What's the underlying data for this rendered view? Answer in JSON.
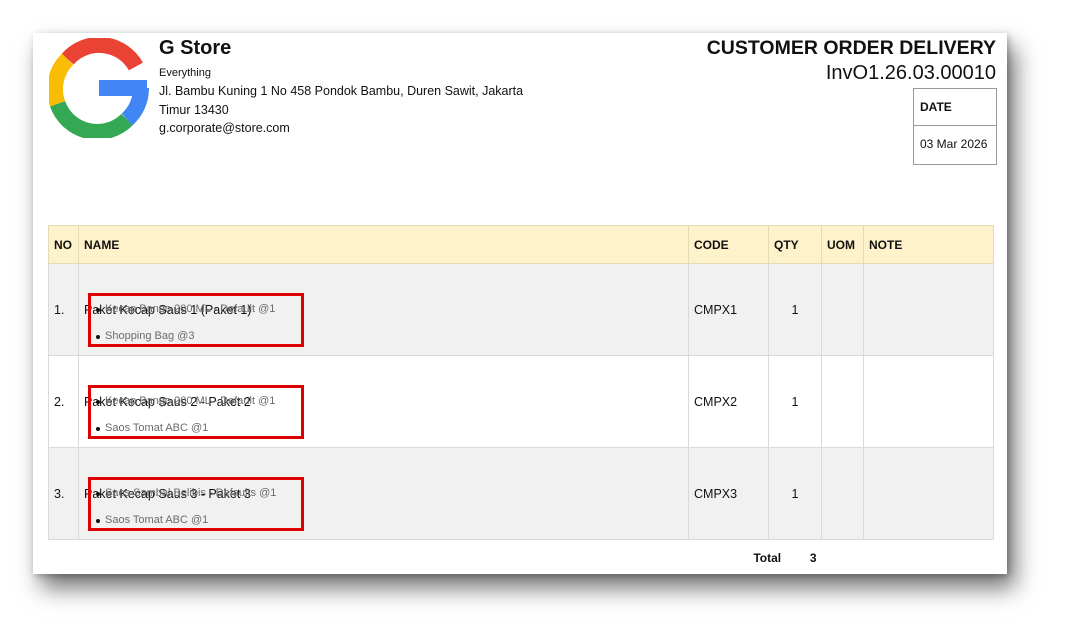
{
  "store": {
    "name": "G Store",
    "tagline": "Everything",
    "address": "Jl. Bambu Kuning 1 No 458 Pondok Bambu, Duren Sawit, Jakarta Timur 13430",
    "email": "g.corporate@store.com",
    "logo_icon": "google-g-logo"
  },
  "document": {
    "title": "CUSTOMER ORDER DELIVERY",
    "number": "InvO1.26.03.00010",
    "date_label": "DATE",
    "date_value": "03 Mar 2026"
  },
  "table": {
    "headers": [
      "NO",
      "NAME",
      "CODE",
      "QTY",
      "UOM",
      "NOTE"
    ],
    "rows": [
      {
        "no": "1.",
        "name": "Paket Kecap Saus 1 (Paket 1)",
        "components": [
          "Kecap Bango 200 ML - Default @1",
          "Shopping Bag @3"
        ],
        "code": "CMPX1",
        "qty": "1",
        "uom": "",
        "note": ""
      },
      {
        "no": "2.",
        "name": "Paket Kecap Saus 2 - Paket 2",
        "components": [
          "Kecap Bango 200 ML - Default @1",
          "Saos Tomat ABC @1"
        ],
        "code": "CMPX2",
        "qty": "1",
        "uom": "",
        "note": ""
      },
      {
        "no": "3.",
        "name": "Paket Kecap Saus 3 - Paket 3",
        "components": [
          "Saos Sambal Belibis - Defaults @1",
          "Saos Tomat ABC @1"
        ],
        "code": "CMPX3",
        "qty": "1",
        "uom": "",
        "note": ""
      }
    ],
    "total_label": "Total",
    "total_value": "3"
  },
  "colors": {
    "header_bg": "#fdf2c9",
    "highlight_border": "#e00000",
    "alt_row_bg": "#f1f1f1"
  }
}
